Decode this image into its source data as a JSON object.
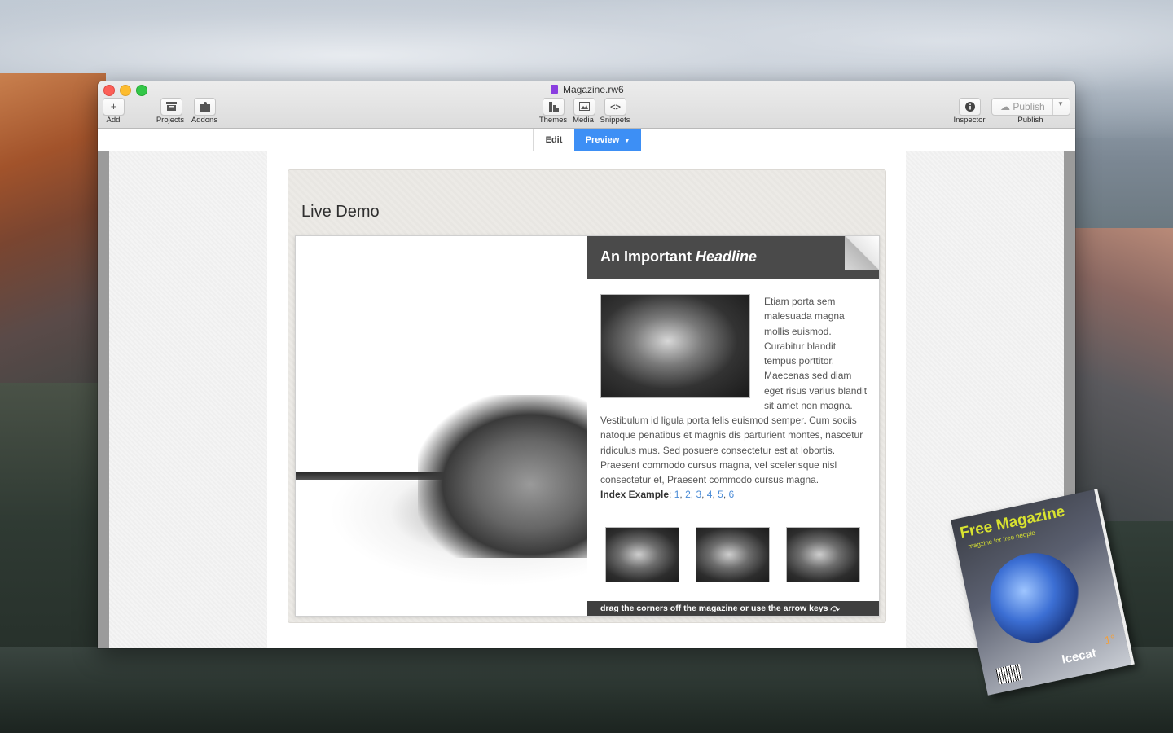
{
  "window": {
    "title": "Magazine.rw6"
  },
  "toolbar": {
    "add": "Add",
    "projects": "Projects",
    "addons": "Addons",
    "themes": "Themes",
    "media": "Media",
    "snippets": "Snippets",
    "inspector": "Inspector",
    "publish_button": "Publish",
    "publish_label": "Publish"
  },
  "modes": {
    "edit": "Edit",
    "preview": "Preview"
  },
  "demo": {
    "title": "Live Demo"
  },
  "article": {
    "headline_1": "An Important ",
    "headline_2": "Headline",
    "side_text": "Etiam porta sem malesuada magna mollis euismod. Curabitur blandit tempus porttitor. Maecenas sed diam eget risus varius blandit sit amet non magna.",
    "body_text": "Vestibulum id ligula porta felis euismod semper. Cum sociis natoque penatibus et magnis dis parturient montes, nascetur ridiculus mus. Sed posuere consectetur est at lobortis. Praesent commodo cursus magna, vel scelerisque nisl consectetur et, Praesent commodo cursus magna.",
    "index_label": "Index Example",
    "index_links": [
      "1",
      "2",
      "3",
      "4",
      "5",
      "6"
    ],
    "footer": "drag the corners off the magazine or use the arrow keys ⤼"
  },
  "cover": {
    "title": "Free Magazine",
    "subtitle": "magzine for free people",
    "name": "Icecat",
    "number": "1°"
  },
  "colors": {
    "accent": "#3d8ff5",
    "headline_bar": "#4a4a4a",
    "link": "#4a8bd6"
  }
}
